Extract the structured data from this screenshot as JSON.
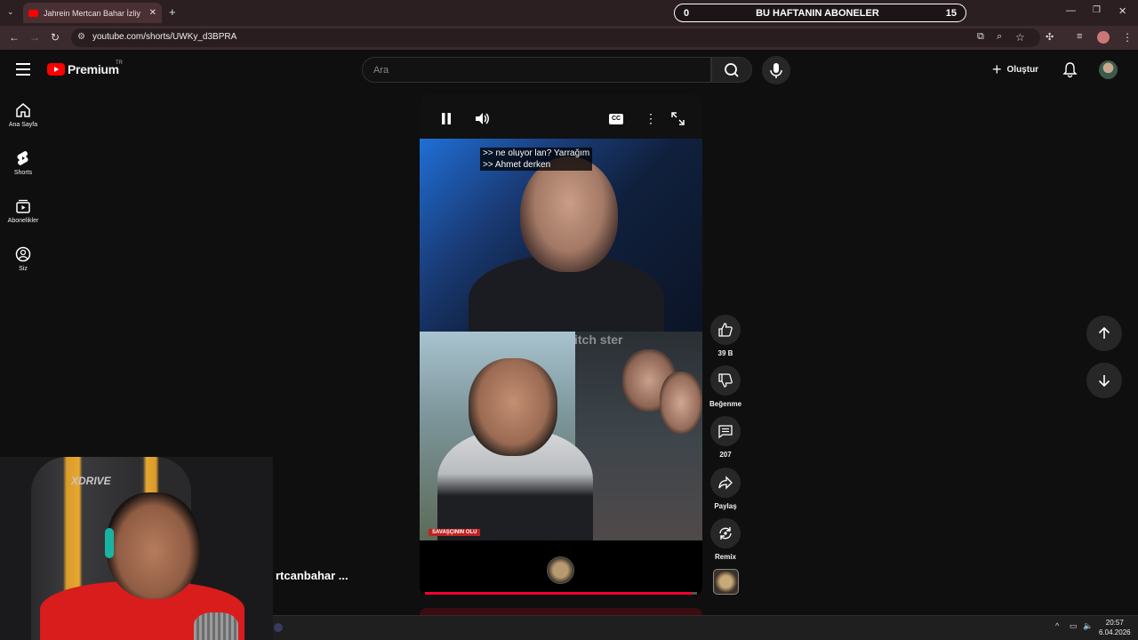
{
  "browser": {
    "tab_title": "Jahrein Mertcan Bahar İzliy",
    "url": "youtube.com/shorts/UWKy_d3BPRA"
  },
  "overlay_banner": {
    "left_count": "0",
    "title": "BU HAFTANIN ABONELER",
    "right_count": "15"
  },
  "youtube": {
    "logo_text": "Premium",
    "logo_region": "TR",
    "search_placeholder": "Ara",
    "create_label": "Oluştur",
    "sidebar": [
      {
        "label": "Ana Sayfa",
        "icon": "home-icon"
      },
      {
        "label": "Shorts",
        "icon": "shorts-icon"
      },
      {
        "label": "Abonelikler",
        "icon": "subscriptions-icon"
      },
      {
        "label": "Siz",
        "icon": "you-icon"
      }
    ],
    "video": {
      "caption_line1": ">> ne oluyor lan? Yarrağım",
      "caption_line2": ">> Ahmet derken",
      "lower_tag": "SAVAŞÇININ OLU",
      "watermark": "itch ster",
      "progress_percent": 98
    },
    "actions": {
      "like_count": "39 B",
      "dislike_label": "Beğenme",
      "comment_count": "207",
      "share_label": "Paylaş",
      "remix_label": "Remix"
    },
    "channel_title": "rtcanbahar ..."
  },
  "webcam": {
    "chair_brand": "XDRIVE"
  },
  "taskbar": {
    "time": "20:57",
    "date": "6.04.2026"
  },
  "colors": {
    "accent": "#ff0000",
    "background": "#0f0f0f",
    "tabbar": "#2b1f22"
  }
}
